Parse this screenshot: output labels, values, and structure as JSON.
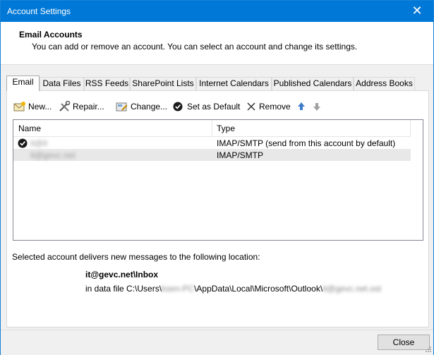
{
  "window": {
    "title": "Account Settings",
    "close_glyph": "✕"
  },
  "header": {
    "title": "Email Accounts",
    "subtitle": "You can add or remove an account. You can select an account and change its settings."
  },
  "tabs": [
    {
      "label": "Email",
      "active": true
    },
    {
      "label": "Data Files"
    },
    {
      "label": "RSS Feeds"
    },
    {
      "label": "SharePoint Lists"
    },
    {
      "label": "Internet Calendars"
    },
    {
      "label": "Published Calendars"
    },
    {
      "label": "Address Books"
    }
  ],
  "toolbar": {
    "new": "New...",
    "repair": "Repair...",
    "change": "Change...",
    "set_default": "Set as Default",
    "remove": "Remove"
  },
  "list": {
    "col_name": "Name",
    "col_type": "Type",
    "rows": [
      {
        "name": "it@it",
        "type": "IMAP/SMTP (send from this account by default)",
        "default": true
      },
      {
        "name": "it@gevc.net",
        "type": "IMAP/SMTP",
        "selected": true
      }
    ]
  },
  "delivery": {
    "text": "Selected account delivers new messages to the following location:",
    "folder": "it@gevc.net\\Inbox",
    "file_prefix": "in data file C:\\Users\\",
    "file_user": "ksen-PC",
    "file_middle": "\\AppData\\Local\\Microsoft\\Outlook\\",
    "file_name": "it@gevc.net.ost"
  },
  "buttons": {
    "close": "Close"
  },
  "colors": {
    "accent": "#0078d7",
    "selection": "#e8e8e8"
  }
}
